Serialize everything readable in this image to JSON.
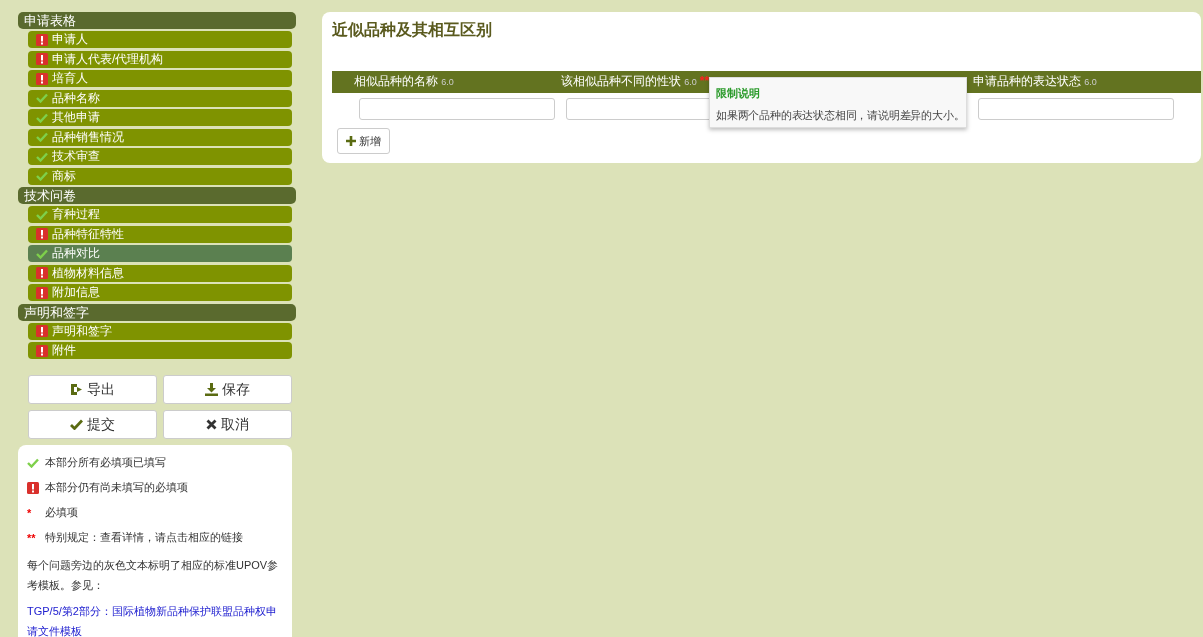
{
  "sidebar": {
    "sections": [
      {
        "title": "申请表格",
        "items": [
          {
            "label": "申请人",
            "complete": false,
            "selected": false
          },
          {
            "label": "申请人代表/代理机构",
            "complete": false,
            "selected": false
          },
          {
            "label": "培育人",
            "complete": false,
            "selected": false
          },
          {
            "label": "品种名称",
            "complete": true,
            "selected": false
          },
          {
            "label": "其他申请",
            "complete": true,
            "selected": false
          },
          {
            "label": "品种销售情况",
            "complete": true,
            "selected": false
          },
          {
            "label": "技术审查",
            "complete": true,
            "selected": false
          },
          {
            "label": "商标",
            "complete": true,
            "selected": false
          }
        ]
      },
      {
        "title": "技术问卷",
        "items": [
          {
            "label": "育种过程",
            "complete": true,
            "selected": false
          },
          {
            "label": "品种特征特性",
            "complete": false,
            "selected": false
          },
          {
            "label": "品种对比",
            "complete": true,
            "selected": true
          },
          {
            "label": "植物材料信息",
            "complete": false,
            "selected": false
          },
          {
            "label": "附加信息",
            "complete": false,
            "selected": false
          }
        ]
      },
      {
        "title": "声明和签字",
        "items": [
          {
            "label": "声明和签字",
            "complete": false,
            "selected": false
          },
          {
            "label": "附件",
            "complete": false,
            "selected": false
          }
        ]
      }
    ],
    "buttons": [
      {
        "label": "导出",
        "kind": "export"
      },
      {
        "label": "保存",
        "kind": "save"
      },
      {
        "label": "提交",
        "kind": "submit"
      },
      {
        "label": "取消",
        "kind": "cancel"
      }
    ],
    "legend": [
      {
        "kind": "ok",
        "text": "本部分所有必填项已填写"
      },
      {
        "kind": "error",
        "text": "本部分仍有尚未填写的必填项"
      },
      {
        "kind": "mark",
        "mark": "*",
        "text": "必填项"
      },
      {
        "kind": "mark",
        "mark": "**",
        "text": "特别规定：查看详情，请点击相应的链接"
      },
      {
        "kind": "note",
        "text": "每个问题旁边的灰色文本标明了相应的标准UPOV参考模板。参见："
      },
      {
        "kind": "link",
        "text": "TGP/5/第2部分：国际植物新品种保护联盟品种权申请文件模板"
      }
    ]
  },
  "main": {
    "title": "近似品种及其相互区别",
    "columns": [
      {
        "label": "相似品种的名称",
        "ref": "6.0"
      },
      {
        "label": "该相似品种不同的性状",
        "ref": "6.0",
        "mark": "**"
      },
      {
        "label": "申请品种的表达状态",
        "ref": "6.0"
      }
    ],
    "add_button": "新增",
    "tooltip": {
      "title": "限制说明",
      "text": "如果两个品种的表达状态相同，请说明差异的大小。"
    }
  }
}
